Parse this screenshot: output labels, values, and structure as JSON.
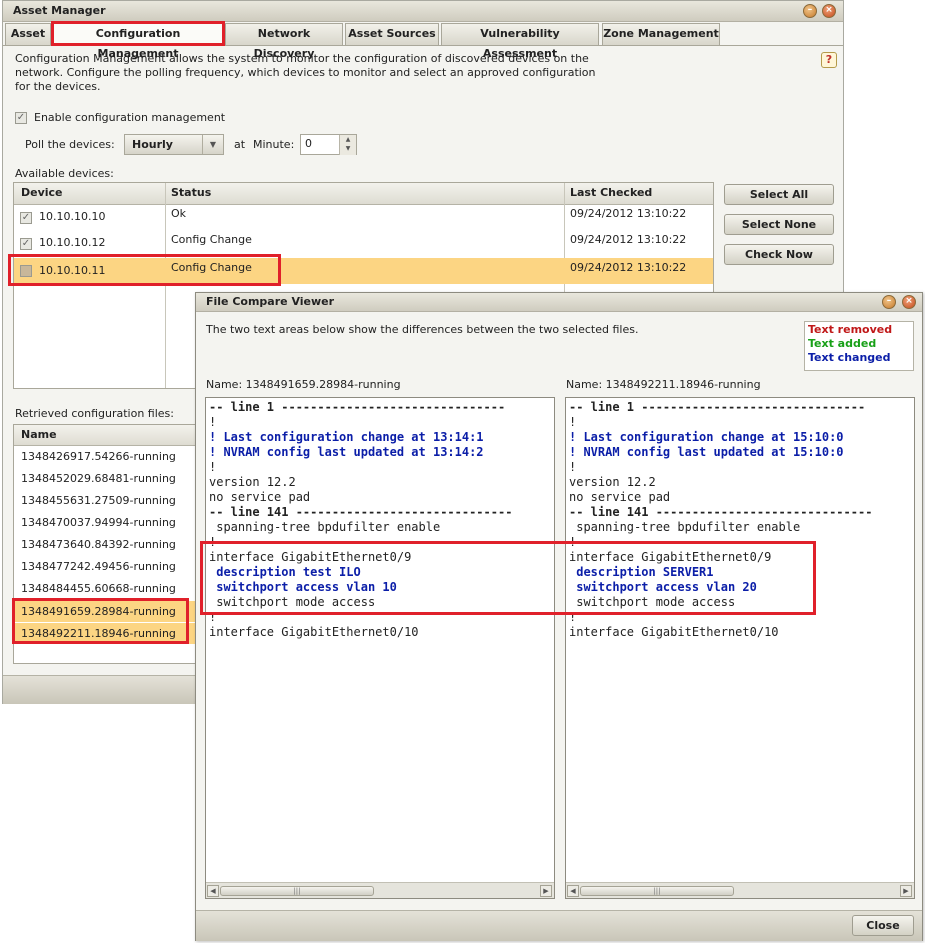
{
  "asset_manager": {
    "title": "Asset Manager",
    "tabs": [
      {
        "label": "Asset"
      },
      {
        "label": "Configuration Management"
      },
      {
        "label": "Network Discovery"
      },
      {
        "label": "Asset Sources"
      },
      {
        "label": "Vulnerability Assessment"
      },
      {
        "label": "Zone Management"
      }
    ],
    "active_tab": "Configuration Management",
    "description": "Configuration Management allows the system to monitor the configuration of discovered devices on the network.  Configure the polling frequency, which devices to monitor and select an approved configuration for the devices.",
    "help_glyph": "?",
    "enable_label": "Enable configuration management",
    "enable_checked": true,
    "poll_label": "Poll the devices:",
    "poll_value": "Hourly",
    "at_label": "at",
    "minute_label": "Minute:",
    "minute_value": "0",
    "available_label": "Available devices:",
    "device_columns": {
      "device": "Device",
      "status": "Status",
      "last_checked": "Last Checked"
    },
    "devices": [
      {
        "device": "10.10.10.10",
        "status": "Ok",
        "last_checked": "09/24/2012 13:10:22",
        "checked": true
      },
      {
        "device": "10.10.10.12",
        "status": "Config Change",
        "last_checked": "09/24/2012 13:10:22",
        "checked": true
      },
      {
        "device": "10.10.10.11",
        "status": "Config Change",
        "last_checked": "09/24/2012 13:10:22",
        "checked": false,
        "selected": true
      }
    ],
    "buttons": {
      "select_all": "Select All",
      "select_none": "Select None",
      "check_now": "Check Now"
    },
    "retrieved_label": "Retrieved configuration files:",
    "files_column": "Name",
    "files": [
      "1348426917.54266-running",
      "1348452029.68481-running",
      "1348455631.27509-running",
      "1348470037.94994-running",
      "1348473640.84392-running",
      "1348477242.49456-running",
      "1348484455.60668-running",
      "1348491659.28984-running",
      "1348492211.18946-running"
    ]
  },
  "compare_viewer": {
    "title": "File Compare Viewer",
    "intro": "The two text areas below show the differences between the two selected files.",
    "legend": {
      "removed": "Text removed",
      "added": "Text added",
      "changed": "Text changed"
    },
    "legend_colors": {
      "removed": "#c01818",
      "added": "#18a018",
      "changed": "#0b1ea8"
    },
    "left": {
      "name_label": "Name: 1348491659.28984-running",
      "lines": {
        "l1": "-- line 1 -------------------------------",
        "l2": "!",
        "l3": "! Last configuration change at 13:14:1",
        "l4": "! NVRAM config last updated at 13:14:2",
        "l5": "!",
        "l6": "version 12.2",
        "l7": "no service pad",
        "l8": "-- line 141 ------------------------------",
        "l9": " spanning-tree bpdufilter enable",
        "l10": "!",
        "l11": "interface GigabitEthernet0/9",
        "l12": " description test ILO",
        "l13": " switchport access vlan 10",
        "l14": " switchport mode access",
        "l15": "!",
        "l16": "interface GigabitEthernet0/10"
      }
    },
    "right": {
      "name_label": "Name: 1348492211.18946-running",
      "lines": {
        "l1": "-- line 1 -------------------------------",
        "l2": "!",
        "l3": "! Last configuration change at 15:10:0",
        "l4": "! NVRAM config last updated at 15:10:0",
        "l5": "!",
        "l6": "version 12.2",
        "l7": "no service pad",
        "l8": "-- line 141 ------------------------------",
        "l9": " spanning-tree bpdufilter enable",
        "l10": "!",
        "l11": "interface GigabitEthernet0/9",
        "l12": " description SERVER1",
        "l13": " switchport access vlan 20",
        "l14": " switchport mode access",
        "l15": "!",
        "l16": "interface GigabitEthernet0/10"
      }
    },
    "scroll_grip": "|||",
    "close_label": "Close"
  },
  "colors": {
    "highlight_row": "#fcd583",
    "annotation_red": "#e0202a",
    "changed_text": "#0b1ea8"
  }
}
